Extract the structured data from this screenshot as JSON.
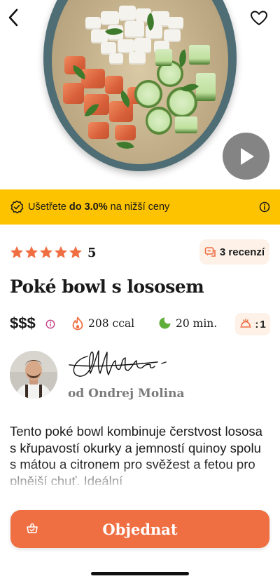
{
  "promo": {
    "prefix": "Ušetřete",
    "highlight": "do 3.0%",
    "suffix": "na nižší ceny"
  },
  "rating": {
    "stars": 5,
    "value": "5",
    "reviews_label": "3 recenzí"
  },
  "recipe": {
    "title": "Poké bowl s lososem",
    "price_level": "$$$",
    "calories": "208 ccal",
    "time": "20 min.",
    "servings": "1"
  },
  "author": {
    "name": "od Ondrej Molina"
  },
  "description": "Tento poké bowl kombinuje čerstvost lososa s křupavostí okurky a jemností quinoy spolu s mátou a citronem pro svěžest a fetou pro plnější chuť. Ideální",
  "actions": {
    "order_label": "Objednat"
  },
  "colors": {
    "accent": "#ef6f43",
    "promo_bg": "#fdc300",
    "chip_bg": "#fdf1e8"
  },
  "icons": {
    "back": "chevron-left-icon",
    "favorite": "heart-icon",
    "play": "play-icon",
    "promo": "discount-badge-icon",
    "info": "info-icon",
    "star": "star-icon",
    "reviews": "review-icon",
    "calories": "flame-icon",
    "time": "clock-icon",
    "servings": "serving-dish-icon",
    "order": "basket-icon"
  }
}
